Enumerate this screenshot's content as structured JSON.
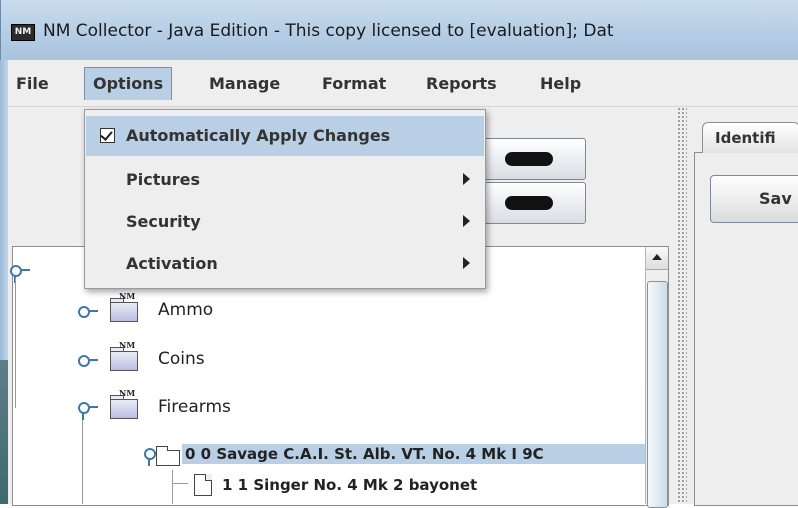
{
  "window": {
    "title": "NM Collector - Java Edition - This copy licensed to [evaluation]; Dat",
    "app_icon_text": "NM"
  },
  "menubar": {
    "items": [
      {
        "label": "File"
      },
      {
        "label": "Options"
      },
      {
        "label": "Manage"
      },
      {
        "label": "Format"
      },
      {
        "label": "Reports"
      },
      {
        "label": "Help"
      }
    ],
    "active": "Options"
  },
  "options_menu": {
    "items": [
      {
        "label": "Automatically Apply Changes",
        "checked": true,
        "submenu": false
      },
      {
        "label": "Pictures",
        "submenu": true
      },
      {
        "label": "Security",
        "submenu": true
      },
      {
        "label": "Activation",
        "submenu": true
      }
    ]
  },
  "tree": {
    "nodes": [
      {
        "label": "Ammo",
        "type": "nm-folder"
      },
      {
        "label": "Coins",
        "type": "nm-folder"
      },
      {
        "label": "Firearms",
        "type": "nm-folder"
      },
      {
        "label": "0 0 Savage C.A.I. St. Alb. VT. No. 4 Mk I 9C",
        "type": "folder",
        "selected": true
      },
      {
        "label": "1 1 Singer No. 4 Mk 2 bayonet",
        "type": "document"
      }
    ]
  },
  "right_panel": {
    "tab_label": "Identifi",
    "save_label": "Sav"
  },
  "colors": {
    "highlight": "#b8cfe5",
    "menu_bg": "#eeeeee"
  }
}
